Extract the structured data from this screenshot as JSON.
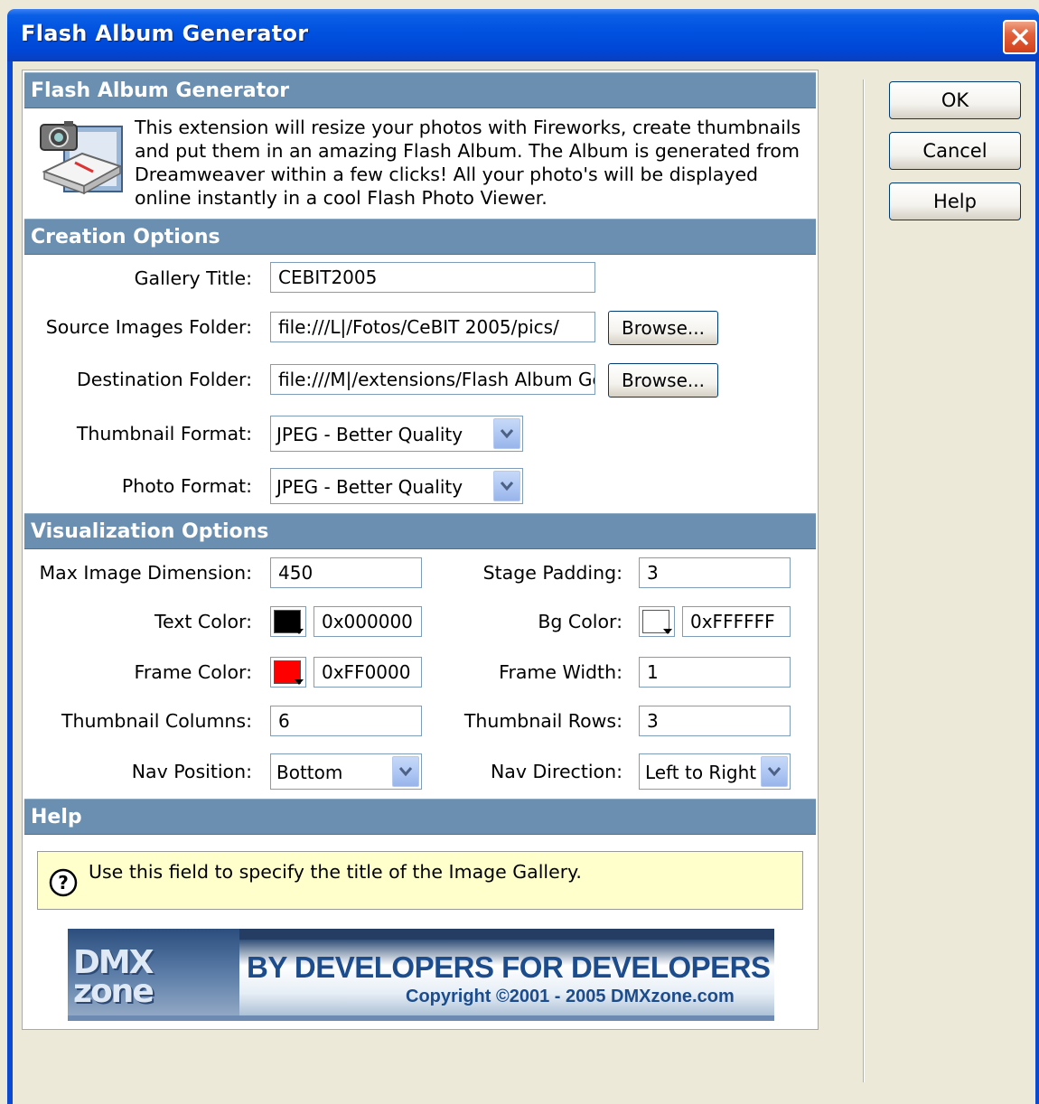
{
  "window": {
    "title": "Flash Album Generator"
  },
  "intro": {
    "header": "Flash Album Generator",
    "text": "This extension will resize your photos with Fireworks, create thumbnails and put them in an amazing Flash Album. The Album is generated from Dreamweaver within a few clicks! All your photo's will be displayed online instantly in a cool Flash Photo Viewer."
  },
  "creation": {
    "header": "Creation Options",
    "gallery_title": {
      "label": "Gallery Title:",
      "value": "CEBIT2005"
    },
    "source_folder": {
      "label": "Source Images Folder:",
      "value": "file:///L|/Fotos/CeBIT 2005/pics/",
      "browse": "Browse..."
    },
    "dest_folder": {
      "label": "Destination Folder:",
      "value": "file:///M|/extensions/Flash Album Ge",
      "browse": "Browse..."
    },
    "thumb_format": {
      "label": "Thumbnail Format:",
      "value": "JPEG - Better Quality"
    },
    "photo_format": {
      "label": "Photo Format:",
      "value": "JPEG - Better Quality"
    }
  },
  "visualization": {
    "header": "Visualization Options",
    "max_dim": {
      "label": "Max Image Dimension:",
      "value": "450"
    },
    "stage_padding": {
      "label": "Stage Padding:",
      "value": "3"
    },
    "text_color": {
      "label": "Text Color:",
      "value": "0x000000",
      "swatch": "#000000"
    },
    "bg_color": {
      "label": "Bg Color:",
      "value": "0xFFFFFF",
      "swatch": "#ffffff"
    },
    "frame_color": {
      "label": "Frame Color:",
      "value": "0xFF0000",
      "swatch": "#ff0000"
    },
    "frame_width": {
      "label": "Frame Width:",
      "value": "1"
    },
    "thumb_columns": {
      "label": "Thumbnail Columns:",
      "value": "6"
    },
    "thumb_rows": {
      "label": "Thumbnail Rows:",
      "value": "3"
    },
    "nav_position": {
      "label": "Nav Position:",
      "value": "Bottom"
    },
    "nav_direction": {
      "label": "Nav Direction:",
      "value": "Left to Right"
    }
  },
  "help": {
    "header": "Help",
    "text": "Use this field to specify the title of the Image Gallery."
  },
  "banner": {
    "logo": "DMX zone",
    "tagline": "BY DEVELOPERS FOR DEVELOPERS",
    "copyright": "Copyright ©2001 - 2005 DMXzone.com"
  },
  "buttons": {
    "ok": "OK",
    "cancel": "Cancel",
    "help": "Help"
  }
}
